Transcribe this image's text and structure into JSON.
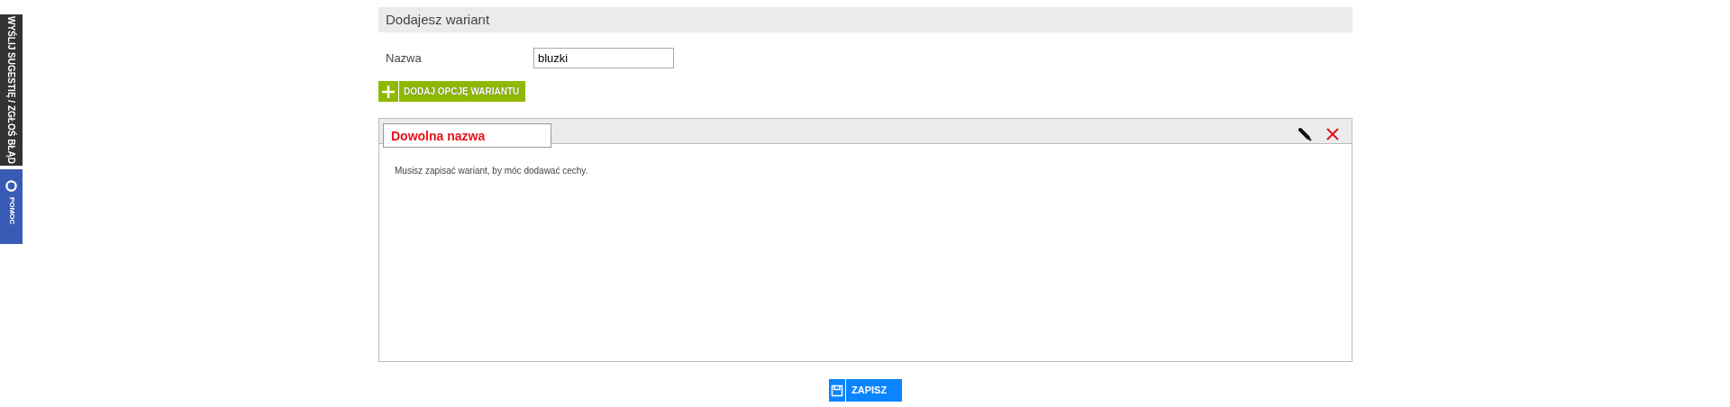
{
  "side_tabs": [
    {
      "kind": "feedback",
      "label": "WYŚLIJ SUGESTIĘ / ZGŁOŚ BŁĄD"
    },
    {
      "kind": "help",
      "label": "POMOC"
    }
  ],
  "header": {
    "title": "Dodajesz wariant"
  },
  "form": {
    "label": "Nazwa",
    "value": "bluzki"
  },
  "add_button": "DODAJ OPCJĘ WARIANTU",
  "option_panel": {
    "name_value": "Dowolna nazwa",
    "message": "Musisz zapisać wariant, by móc dodawać cechy."
  },
  "save_button": "ZAPISZ"
}
